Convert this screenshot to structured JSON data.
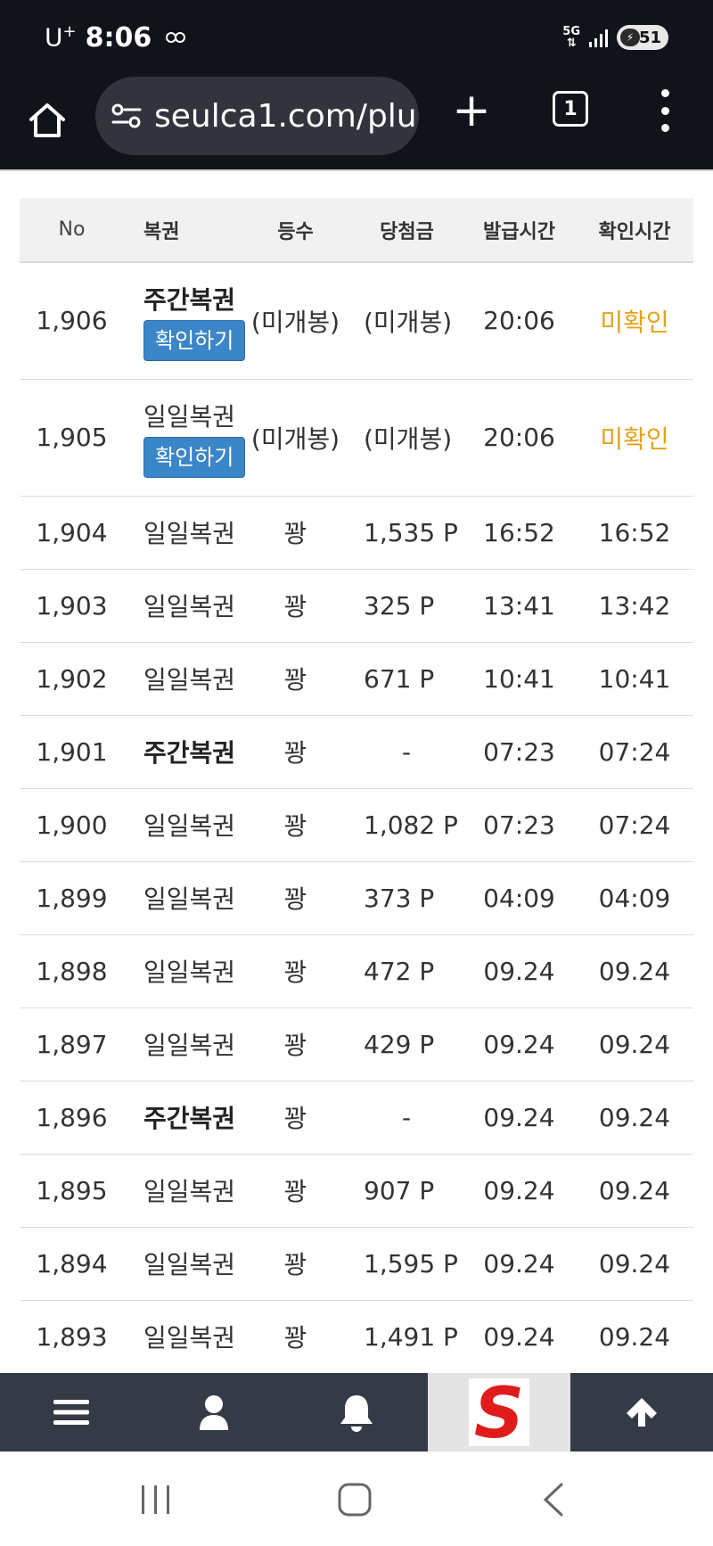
{
  "status_bar": {
    "carrier": "U",
    "carrier_sup": "+",
    "time": "8:06",
    "network": "5G",
    "battery": "51"
  },
  "browser": {
    "url": "seulca1.com/plu",
    "tab_count": "1",
    "new_tab_symbol": "+"
  },
  "table": {
    "headers": [
      "No",
      "복권",
      "등수",
      "당첨금",
      "발급시간",
      "확인시간"
    ],
    "check_button_label": "확인하기",
    "rows": [
      {
        "no": "1,906",
        "type": "주간복권",
        "rank": "(미개봉)",
        "prize": "(미개봉)",
        "issued": "20:06",
        "checked": "미확인"
      },
      {
        "no": "1,905",
        "type": "일일복권",
        "rank": "(미개봉)",
        "prize": "(미개봉)",
        "issued": "20:06",
        "checked": "미확인"
      },
      {
        "no": "1,904",
        "type": "일일복권",
        "rank": "꽝",
        "prize": "1,535 P",
        "issued": "16:52",
        "checked": "16:52"
      },
      {
        "no": "1,903",
        "type": "일일복권",
        "rank": "꽝",
        "prize": "325 P",
        "issued": "13:41",
        "checked": "13:42"
      },
      {
        "no": "1,902",
        "type": "일일복권",
        "rank": "꽝",
        "prize": "671 P",
        "issued": "10:41",
        "checked": "10:41"
      },
      {
        "no": "1,901",
        "type": "주간복권",
        "rank": "꽝",
        "prize": "-",
        "issued": "07:23",
        "checked": "07:24"
      },
      {
        "no": "1,900",
        "type": "일일복권",
        "rank": "꽝",
        "prize": "1,082 P",
        "issued": "07:23",
        "checked": "07:24"
      },
      {
        "no": "1,899",
        "type": "일일복권",
        "rank": "꽝",
        "prize": "373 P",
        "issued": "04:09",
        "checked": "04:09"
      },
      {
        "no": "1,898",
        "type": "일일복권",
        "rank": "꽝",
        "prize": "472 P",
        "issued": "09.24",
        "checked": "09.24"
      },
      {
        "no": "1,897",
        "type": "일일복권",
        "rank": "꽝",
        "prize": "429 P",
        "issued": "09.24",
        "checked": "09.24"
      },
      {
        "no": "1,896",
        "type": "주간복권",
        "rank": "꽝",
        "prize": "-",
        "issued": "09.24",
        "checked": "09.24"
      },
      {
        "no": "1,895",
        "type": "일일복권",
        "rank": "꽝",
        "prize": "907 P",
        "issued": "09.24",
        "checked": "09.24"
      },
      {
        "no": "1,894",
        "type": "일일복권",
        "rank": "꽝",
        "prize": "1,595 P",
        "issued": "09.24",
        "checked": "09.24"
      },
      {
        "no": "1,893",
        "type": "일일복권",
        "rank": "꽝",
        "prize": "1,491 P",
        "issued": "09.24",
        "checked": "09.24"
      }
    ]
  },
  "bottom_nav": {
    "items": [
      "menu-icon",
      "user-icon",
      "bell-icon",
      "site-logo",
      "arrow-up-icon"
    ],
    "logo_letter": "S"
  },
  "colors": {
    "status_bg": "#11131a",
    "url_bg": "#31343c",
    "check_button": "#3b86c8",
    "unconfirmed": "#e5a21a",
    "nav_bg": "#343b47",
    "logo_red": "#e01b1b"
  }
}
